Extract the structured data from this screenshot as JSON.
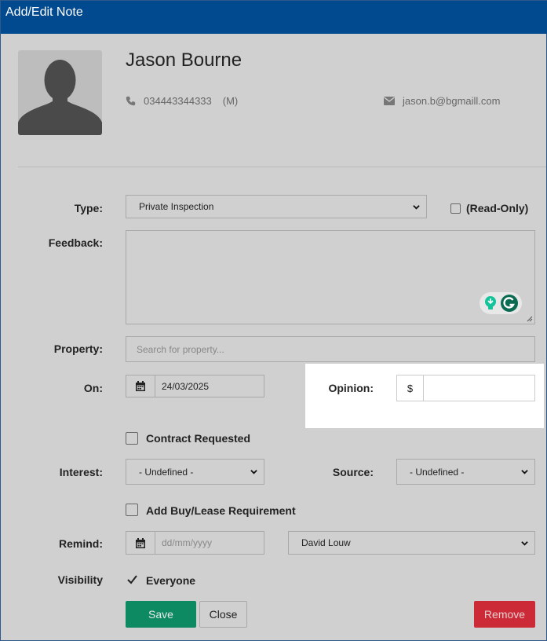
{
  "window": {
    "title": "Add/Edit Note"
  },
  "contact": {
    "name": "Jason Bourne",
    "phone": "034443344333",
    "phone_type": "(M)",
    "email": "jason.b@bgmaill.com"
  },
  "form": {
    "type": {
      "label": "Type:",
      "value": "Private Inspection"
    },
    "read_only": {
      "label": "(Read-Only)",
      "checked": false
    },
    "feedback": {
      "label": "Feedback:",
      "value": ""
    },
    "property": {
      "label": "Property:",
      "placeholder": "Search for property..."
    },
    "on": {
      "label": "On:",
      "value": "24/03/2025"
    },
    "opinion": {
      "label": "Opinion:",
      "currency": "$",
      "value": ""
    },
    "contract_requested": {
      "label": "Contract Requested",
      "checked": false
    },
    "interest": {
      "label": "Interest:",
      "value": "- Undefined -"
    },
    "source": {
      "label": "Source:",
      "value": "- Undefined -"
    },
    "buy_lease": {
      "label": "Add Buy/Lease Requirement",
      "checked": false
    },
    "remind": {
      "label": "Remind:",
      "placeholder": "dd/mm/yyyy",
      "agent": "David Louw"
    },
    "visibility": {
      "label": "Visibility",
      "option_label": "Everyone",
      "checked": true
    }
  },
  "buttons": {
    "save": "Save",
    "close": "Close",
    "remove": "Remove"
  },
  "colors": {
    "titlebar": "#024a8f",
    "save": "#0e8a63",
    "remove": "#cd2a38",
    "grammarly": "#15c39a"
  }
}
